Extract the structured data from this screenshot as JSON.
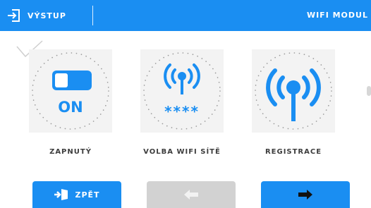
{
  "header": {
    "exit_label": "VÝSTUP",
    "title": "WIFI MODUL"
  },
  "options": [
    {
      "label": "ZAPNUTÝ",
      "state_text": "ON",
      "icon": "toggle-icon"
    },
    {
      "label": "VOLBA WIFI SÍTĚ",
      "mask_text": "****",
      "icon": "wifi-antenna-icon"
    },
    {
      "label": "REGISTRACE",
      "icon": "wifi-antenna-icon"
    }
  ],
  "buttons": {
    "back_label": "ZPĚT",
    "back_icon": "exit-door-icon",
    "prev_icon": "arrow-left-icon",
    "next_icon": "arrow-right-icon"
  },
  "colors": {
    "accent": "#1a8ef2",
    "disabled": "#d2d2d2",
    "tile": "#f3f3f3"
  }
}
